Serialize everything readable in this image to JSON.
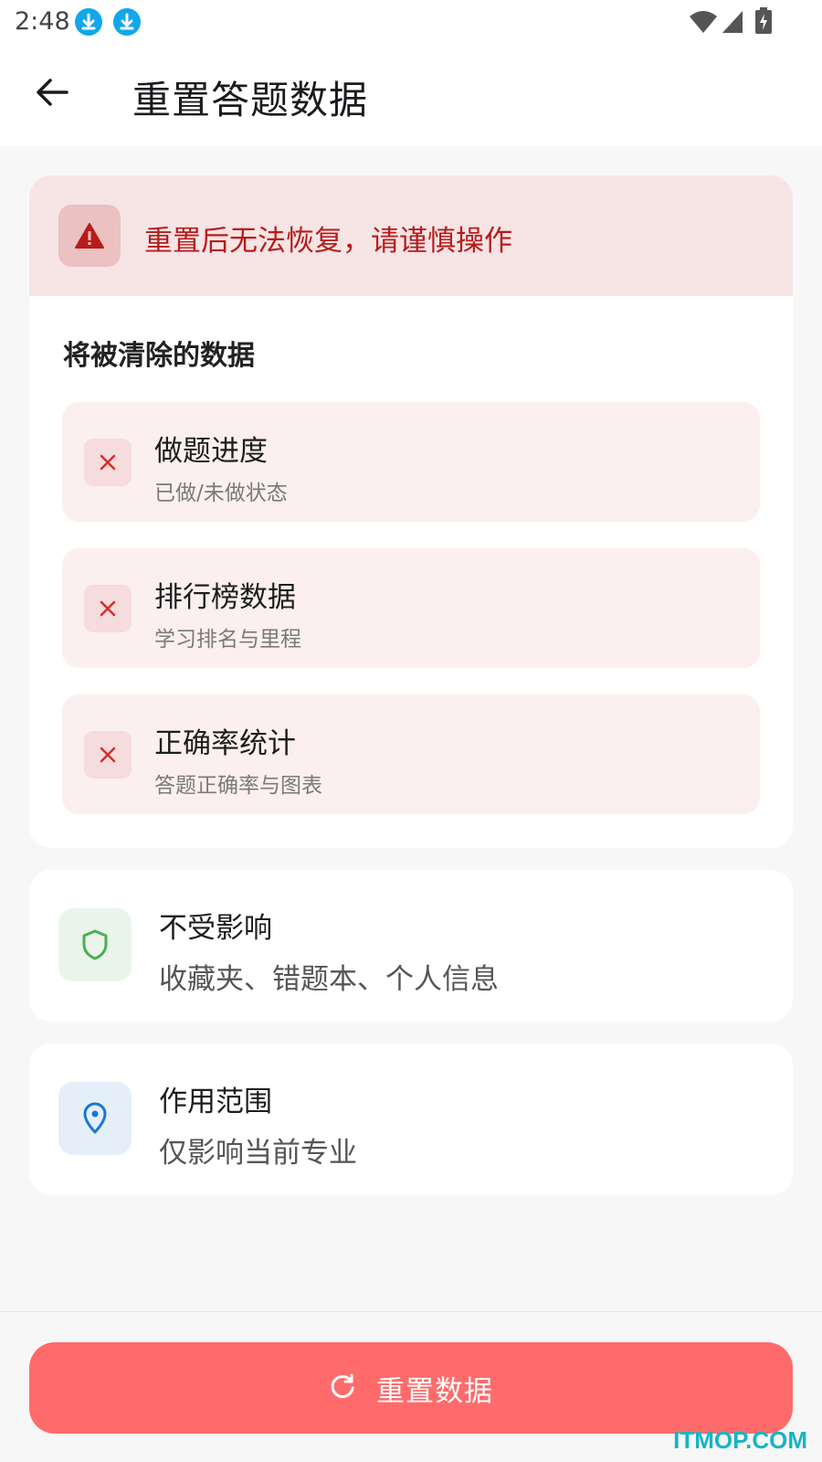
{
  "status_bar": {
    "time": "2:48",
    "icons": [
      "download-icon",
      "download-icon",
      "wifi-icon",
      "signal-icon",
      "battery-charging-icon"
    ]
  },
  "app_bar": {
    "back_icon": "arrow-left-icon",
    "title": "重置答题数据"
  },
  "warning": {
    "icon": "warning-triangle-icon",
    "text": "重置后无法恢复，请谨慎操作",
    "color": "#b71c1c"
  },
  "cleared": {
    "heading": "将被清除的数据",
    "items": [
      {
        "title": "做题进度",
        "subtitle": "已做/未做状态"
      },
      {
        "title": "排行榜数据",
        "subtitle": "学习排名与里程"
      },
      {
        "title": "正确率统计",
        "subtitle": "答题正确率与图表"
      }
    ]
  },
  "unaffected": {
    "icon": "shield-icon",
    "title": "不受影响",
    "subtitle": "收藏夹、错题本、个人信息",
    "color": "#4caf50"
  },
  "scope": {
    "icon": "location-pin-icon",
    "title": "作用范围",
    "subtitle": "仅影响当前专业",
    "color": "#1976d2"
  },
  "action": {
    "icon": "refresh-icon",
    "label": "重置数据",
    "color": "#ff6b6b"
  },
  "watermark": "ITMOP.COM"
}
